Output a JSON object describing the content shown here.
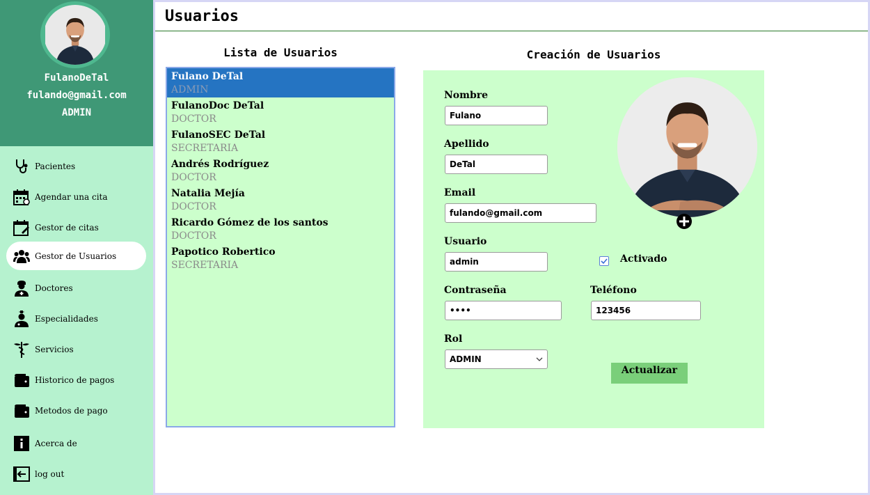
{
  "profile": {
    "username": "FulanoDeTal",
    "email": "fulando@gmail.com",
    "role": "ADMIN"
  },
  "nav": [
    {
      "label": "Pacientes",
      "icon": "stethoscope-icon"
    },
    {
      "label": "Agendar una cita",
      "icon": "calendar-icon"
    },
    {
      "label": "Gestor de citas",
      "icon": "calendar-edit-icon"
    },
    {
      "label": "Gestor de Usuarios",
      "icon": "users-icon",
      "active": true
    },
    {
      "label": "Doctores",
      "icon": "doctor-icon"
    },
    {
      "label": "Especialidades",
      "icon": "specialist-icon"
    },
    {
      "label": "Servicios",
      "icon": "caduceus-icon"
    },
    {
      "label": "Historico de pagos",
      "icon": "wallet-icon"
    },
    {
      "label": "Metodos de pago",
      "icon": "wallet-icon"
    },
    {
      "label": "Acerca de",
      "icon": "info-icon"
    },
    {
      "label": "log out",
      "icon": "logout-icon"
    }
  ],
  "page": {
    "title": "Usuarios"
  },
  "user_list": {
    "heading": "Lista de Usuarios",
    "users": [
      {
        "name": "Fulano DeTal",
        "role": "ADMIN",
        "selected": true
      },
      {
        "name": "FulanoDoc DeTal",
        "role": "DOCTOR"
      },
      {
        "name": "FulanoSEC DeTal",
        "role": "SECRETARIA"
      },
      {
        "name": "Andrés Rodríguez",
        "role": "DOCTOR"
      },
      {
        "name": "Natalia Mejía",
        "role": "DOCTOR"
      },
      {
        "name": "Ricardo Gómez de los santos",
        "role": "DOCTOR"
      },
      {
        "name": "Papotico Robertico",
        "role": "SECRETARIA"
      }
    ]
  },
  "form": {
    "heading": "Creación de Usuarios",
    "nombre_label": "Nombre",
    "nombre_value": "Fulano",
    "apellido_label": "Apellido",
    "apellido_value": "DeTal",
    "email_label": "Email",
    "email_value": "fulando@gmail.com",
    "usuario_label": "Usuario",
    "usuario_value": "admin",
    "activado_label": "Activado",
    "activado_checked": true,
    "password_label": "Contraseña",
    "password_value": "••••",
    "telefono_label": "Teléfono",
    "telefono_value": "123456",
    "rol_label": "Rol",
    "rol_value": "ADMIN",
    "submit_label": "Actualizar"
  },
  "colors": {
    "sidebar_bg": "#b6f2cf",
    "profile_bg": "#3f9876",
    "panel_bg": "#ccffcc",
    "selected_bg": "#2574c2",
    "button_bg": "#7acf7a"
  }
}
